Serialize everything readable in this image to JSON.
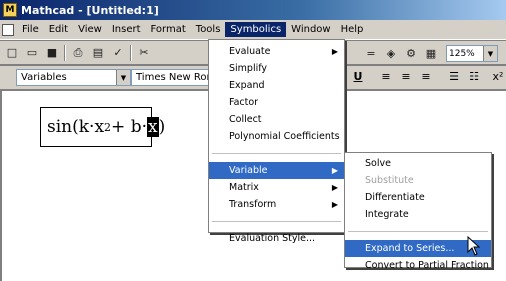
{
  "window": {
    "title": "Mathcad - [Untitled:1]"
  },
  "menubar": [
    "File",
    "Edit",
    "View",
    "Insert",
    "Format",
    "Tools",
    "Symbolics",
    "Window",
    "Help"
  ],
  "toolbar": {
    "zoom": "125%"
  },
  "format_bar": {
    "style": "Variables",
    "font": "Times New Roman"
  },
  "expression": {
    "pre": "sin(k·x",
    "exp": "2",
    "mid": " + b·",
    "selected": "x",
    "post": ")"
  },
  "symbolics_menu": {
    "group1": [
      "Evaluate",
      "Simplify",
      "Expand",
      "Factor",
      "Collect",
      "Polynomial Coefficients"
    ],
    "group2": [
      "Variable",
      "Matrix",
      "Transform"
    ],
    "group3": [
      "Evaluation Style..."
    ]
  },
  "variable_menu": {
    "group1": [
      "Solve",
      "Substitute",
      "Differentiate",
      "Integrate"
    ],
    "group2": [
      "Expand to Series...",
      "Convert to Partial Fraction"
    ]
  }
}
